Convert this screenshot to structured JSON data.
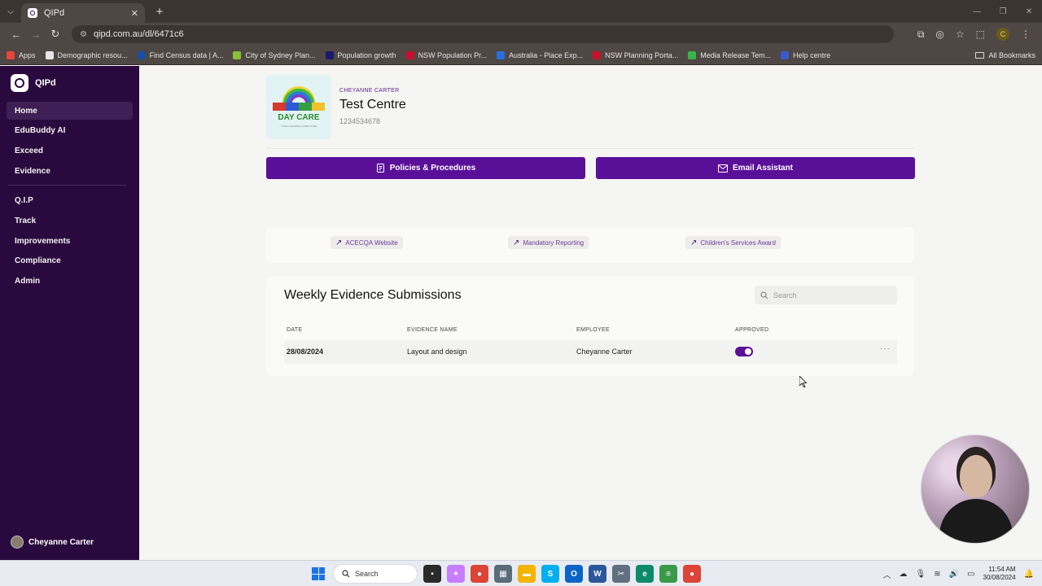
{
  "browser": {
    "tab_title": "QIPd",
    "url": "qipd.com.au/dl/6471c6",
    "bookmarks": [
      {
        "label": "Apps",
        "color": "#e8453c"
      },
      {
        "label": "Demographic resou...",
        "color": "#e6e6e6"
      },
      {
        "label": "Find Census data | A...",
        "color": "#1a4fa0"
      },
      {
        "label": "City of Sydney Plan...",
        "color": "#8bbf3a"
      },
      {
        "label": "Population growth",
        "color": "#1a1a6a"
      },
      {
        "label": "NSW Population Pr...",
        "color": "#c8102e"
      },
      {
        "label": "Australia - Place Exp...",
        "color": "#2b6de0"
      },
      {
        "label": "NSW Planning Porta...",
        "color": "#c8102e"
      },
      {
        "label": "Media Release Tem...",
        "color": "#3bb54a"
      },
      {
        "label": "Help centre",
        "color": "#3a5bd0"
      }
    ],
    "all_bookmarks": "All Bookmarks",
    "profile_initial": "C"
  },
  "sidebar": {
    "brand": "QIPd",
    "items": [
      {
        "label": "Home",
        "active": true
      },
      {
        "label": "EduBuddy AI"
      },
      {
        "label": "Exceed"
      },
      {
        "label": "Evidence"
      },
      {
        "label": "Q.I.P"
      },
      {
        "label": "Track"
      },
      {
        "label": "Improvements"
      },
      {
        "label": "Compliance"
      },
      {
        "label": "Admin"
      }
    ],
    "user_name": "Cheyanne Carter"
  },
  "centre": {
    "owner": "CHEYANNE CARTER",
    "name": "Test Centre",
    "id": "1234534678",
    "logo_text": "DAY CARE",
    "logo_subtext": "YOUR CHILDREN COME HOME"
  },
  "actions": {
    "policies_label": "Policies & Procedures",
    "email_label": "Email Assistant"
  },
  "links": [
    {
      "label": "ACECQA Website"
    },
    {
      "label": "Mandatory Reporting"
    },
    {
      "label": "Children's Services Award"
    }
  ],
  "submissions": {
    "title": "Weekly Evidence Submissions",
    "search_placeholder": "Search",
    "columns": [
      "DATE",
      "EVIDENCE NAME",
      "EMPLOYEE",
      "APPROVED"
    ],
    "rows": [
      {
        "date": "28/08/2024",
        "evidence_name": "Layout and design",
        "employee": "Cheyanne Carter",
        "approved": true
      }
    ]
  },
  "taskbar": {
    "search_label": "Search",
    "time": "11:54 AM",
    "date": "30/08/2024"
  },
  "colors": {
    "sidebar_bg": "#2a0a3e",
    "accent": "#5a0f99"
  }
}
